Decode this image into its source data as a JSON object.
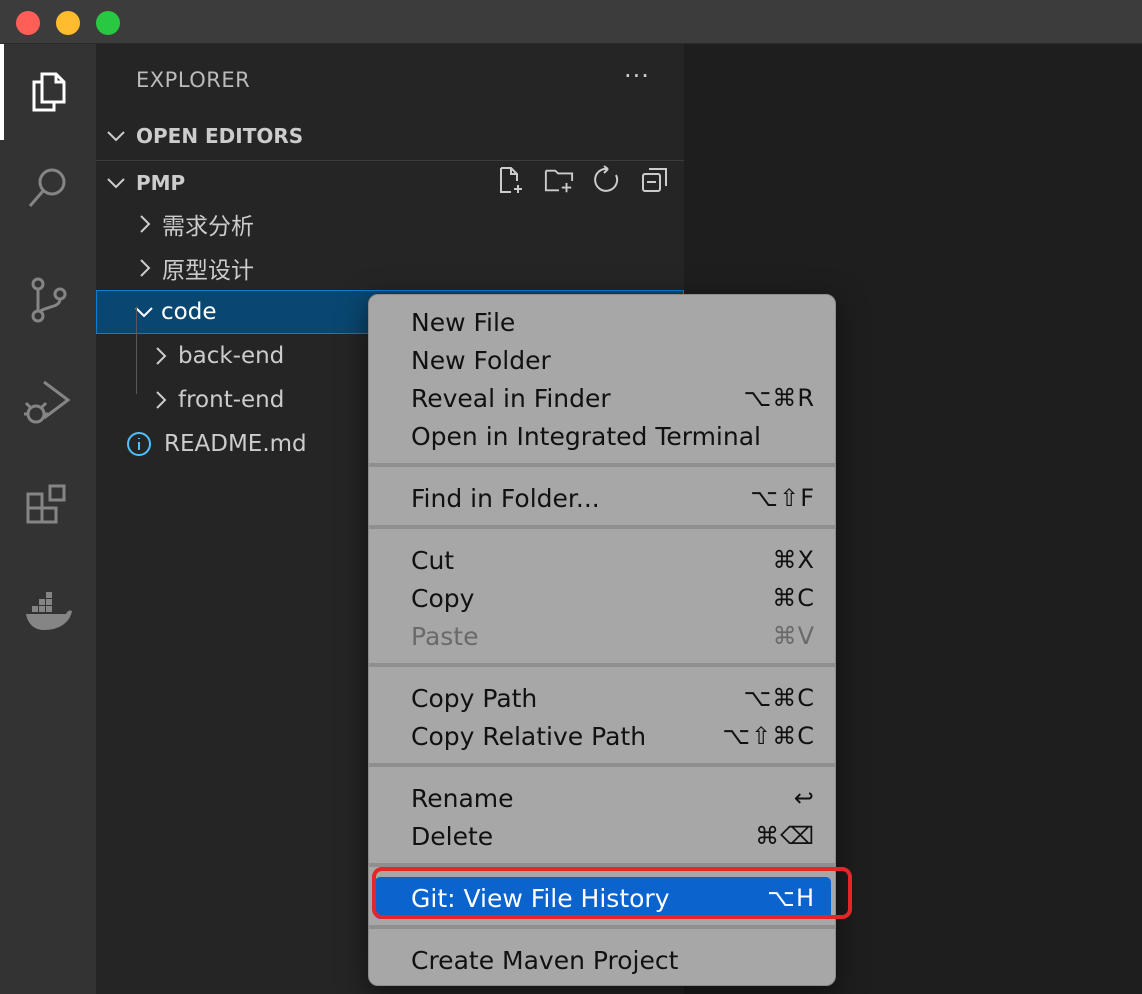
{
  "sidebar": {
    "title": "EXPLORER",
    "more_label": "···",
    "open_editors": "OPEN EDITORS",
    "project": "PMP",
    "tree": [
      {
        "label": "需求分析"
      },
      {
        "label": "原型设计"
      },
      {
        "label": "code"
      },
      {
        "label": "back-end"
      },
      {
        "label": "front-end"
      },
      {
        "label": "README.md"
      }
    ]
  },
  "activity_icons": [
    "files-icon",
    "search-icon",
    "source-control-icon",
    "run-debug-icon",
    "extensions-icon",
    "docker-icon"
  ],
  "context_menu": {
    "items": [
      {
        "label": "New File",
        "shortcut": ""
      },
      {
        "label": "New Folder",
        "shortcut": ""
      },
      {
        "label": "Reveal in Finder",
        "shortcut": "⌥⌘R"
      },
      {
        "label": "Open in Integrated Terminal",
        "shortcut": ""
      },
      {
        "label": "Find in Folder...",
        "shortcut": "⌥⇧F"
      },
      {
        "label": "Cut",
        "shortcut": "⌘X"
      },
      {
        "label": "Copy",
        "shortcut": "⌘C"
      },
      {
        "label": "Paste",
        "shortcut": "⌘V"
      },
      {
        "label": "Copy Path",
        "shortcut": "⌥⌘C"
      },
      {
        "label": "Copy Relative Path",
        "shortcut": "⌥⇧⌘C"
      },
      {
        "label": "Rename",
        "shortcut": "↩"
      },
      {
        "label": "Delete",
        "shortcut": "⌘⌫"
      },
      {
        "label": "Git: View File History",
        "shortcut": "⌥H"
      },
      {
        "label": "Create Maven Project",
        "shortcut": ""
      }
    ]
  },
  "colors": {
    "highlight": "#0b63ce",
    "selection": "#094771",
    "annotation": "#e3262a"
  }
}
